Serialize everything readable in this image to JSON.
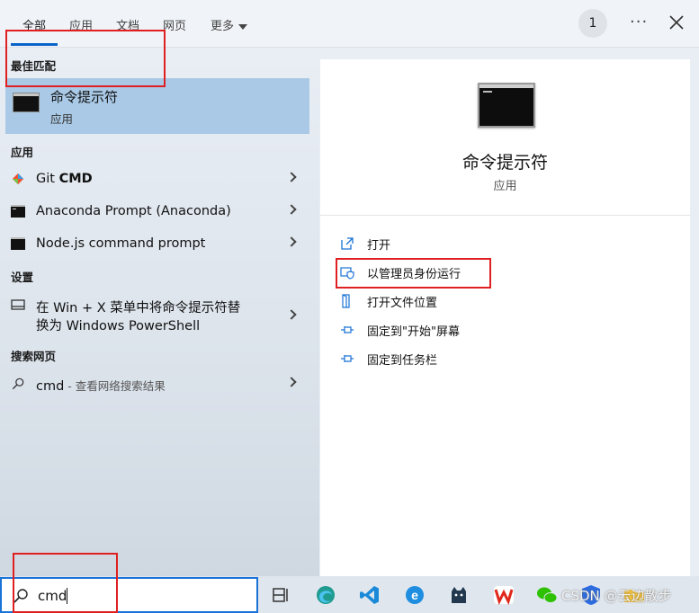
{
  "header": {
    "tabs": [
      {
        "label": "全部",
        "active": true
      },
      {
        "label": "应用"
      },
      {
        "label": "文档"
      },
      {
        "label": "网页"
      },
      {
        "label": "更多"
      }
    ],
    "badge": "1",
    "more_icon": "ellipsis-icon",
    "close_icon": "close-icon"
  },
  "left": {
    "best_match": {
      "header": "最佳匹配",
      "title": "命令提示符",
      "subtitle": "应用"
    },
    "apps_header": "应用",
    "apps": [
      {
        "label_pre": "Git ",
        "label_bold": "CMD",
        "icon": "git-cmd-icon"
      },
      {
        "label": "Anaconda Prompt (Anaconda)",
        "icon": "terminal-icon"
      },
      {
        "label": "Node.js command prompt",
        "icon": "terminal-icon"
      }
    ],
    "settings_header": "设置",
    "setting": {
      "line1": "在 Win + X 菜单中将命令提示符替",
      "line2": "换为 Windows PowerShell",
      "icon": "taskbar-settings-icon"
    },
    "web_header": "搜索网页",
    "web": {
      "query": "cmd",
      "suffix": " - 查看网络搜索结果",
      "icon": "search-icon"
    }
  },
  "right": {
    "title": "命令提示符",
    "subtitle": "应用",
    "actions": [
      {
        "label": "打开",
        "icon": "open-icon"
      },
      {
        "label": "以管理员身份运行",
        "icon": "shield-icon"
      },
      {
        "label": "打开文件位置",
        "icon": "file-location-icon"
      },
      {
        "label": "固定到\"开始\"屏幕",
        "icon": "pin-icon"
      },
      {
        "label": "固定到任务栏",
        "icon": "pin-icon"
      }
    ]
  },
  "taskbar": {
    "search_value": "cmd",
    "icons": [
      "task-view-icon",
      "edge-icon",
      "vscode-icon",
      "browser-e-icon",
      "cat-app-icon",
      "wps-icon",
      "wechat-icon",
      "shield-app-icon",
      "folder-icon"
    ],
    "watermark": "CSDN @云边散步"
  },
  "colors": {
    "accent": "#1a73d6",
    "selected": "#a9c9e6",
    "highlight_box": "#e02020"
  }
}
